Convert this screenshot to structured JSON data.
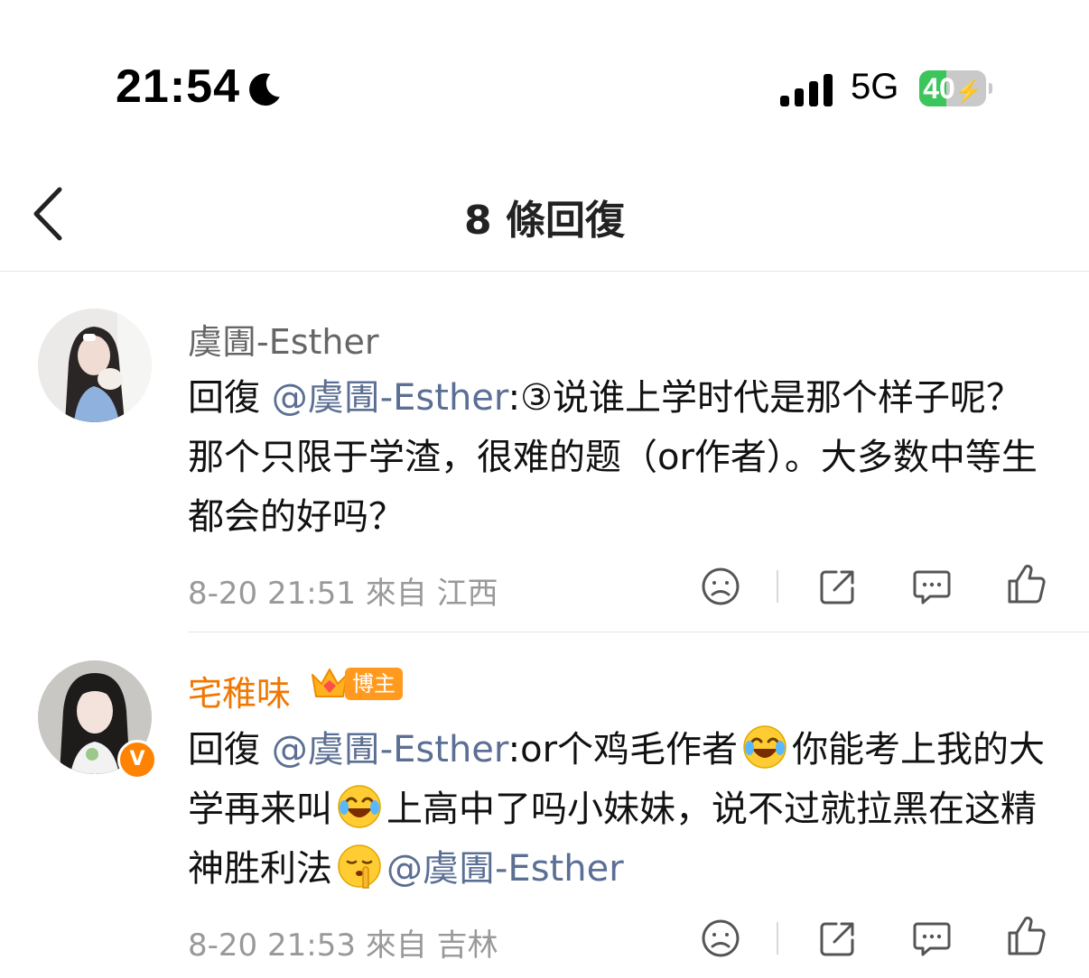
{
  "status_bar": {
    "time": "21:54",
    "network": "5G",
    "battery": "40",
    "battery_level": 0.4,
    "icons": [
      "moon-icon",
      "signal-icon",
      "battery-icon"
    ]
  },
  "header": {
    "title": "8 條回復",
    "back_icon": "chevron-left-icon"
  },
  "comments": [
    {
      "username": "虞圊-Esther",
      "reply_prefix": "回復",
      "mention": "@虞圊-Esther",
      "text": ":③说谁上学时代是那个样子呢？那个只限于学渣，很难的题（or作者）。大多数中等生都会的好吗？",
      "time": "8-20 21:51",
      "location": "來自 江西"
    },
    {
      "username": "宅稚味",
      "badge": "博主",
      "verified": "V",
      "reply_prefix": "回復",
      "mention": "@虞圊-Esther",
      "text_1": ":or个鸡毛作者",
      "text_2": "你能考上我的大学再来叫",
      "text_3": "上高中了吗小妹妹，说不过就拉黑在这精神胜利法",
      "mention_2": "@虞圊-Esther",
      "time": "8-20 21:53",
      "location": "來自 吉林"
    }
  ],
  "colors": {
    "mention": "#5b6f94",
    "vip_name": "#f07700",
    "meta": "#999999",
    "battery_green": "#3cc55a"
  }
}
